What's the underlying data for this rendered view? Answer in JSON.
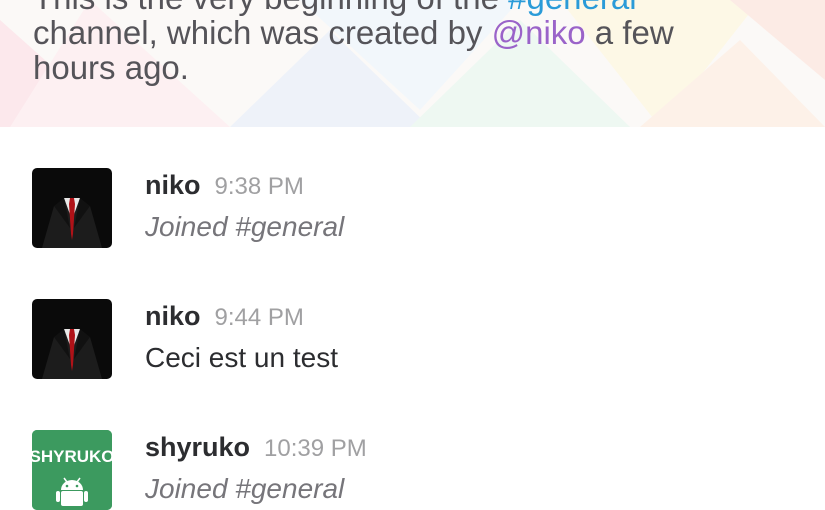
{
  "intro": {
    "line1_prefix": "This is the very beginning of the ",
    "channel_mention": "#general",
    "line2_prefix": "channel, which was created by ",
    "user_mention": "@niko",
    "line2_suffix": " a few",
    "line3": "hours ago."
  },
  "messages": [
    {
      "author": "niko",
      "time": "9:38 PM",
      "text": "Joined #general",
      "type": "system",
      "avatar": "suit"
    },
    {
      "author": "niko",
      "time": "9:44 PM",
      "text": "Ceci est un test",
      "type": "normal",
      "avatar": "suit"
    },
    {
      "author": "shyruko",
      "time": "10:39 PM",
      "text": "Joined #general",
      "type": "system",
      "avatar": "android",
      "avatar_text": "SHYRUKO"
    }
  ],
  "colors": {
    "channel_link": "#2a9bd8",
    "user_link": "#9a63c9",
    "android_green": "#3c9a5f"
  }
}
